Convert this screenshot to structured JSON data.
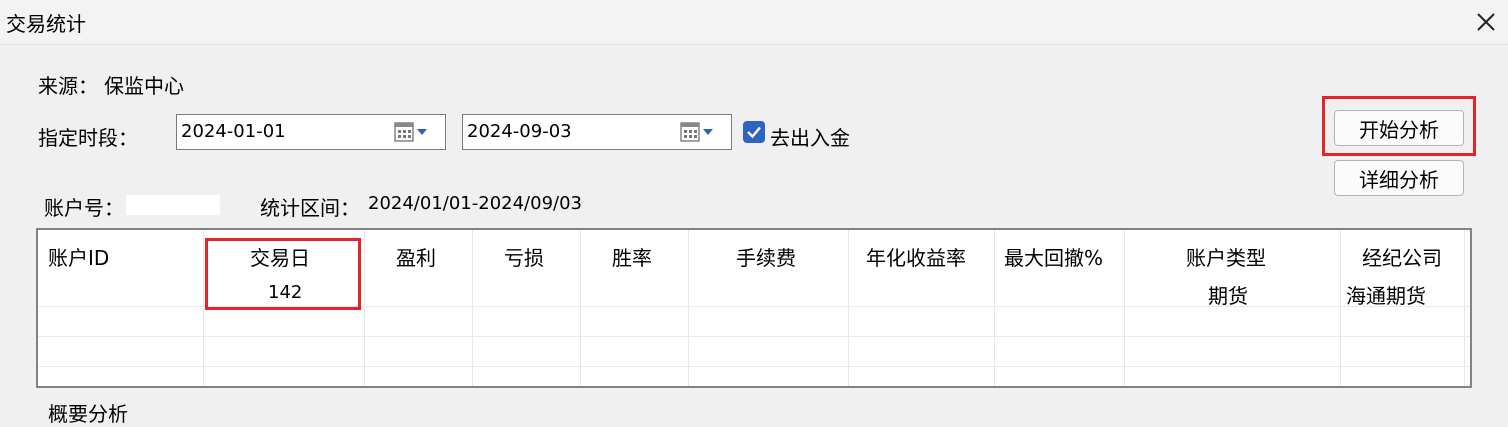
{
  "window": {
    "title": "交易统计"
  },
  "source": {
    "label": "来源：",
    "value": "保监中心"
  },
  "period": {
    "label": "指定时段：",
    "start_date": "2024-01-01",
    "end_date": "2024-09-03",
    "exclude_deposit_label": "去出入金",
    "exclude_deposit_checked": true
  },
  "buttons": {
    "start_analysis": "开始分析",
    "detail_analysis": "详细分析"
  },
  "account": {
    "label": "账户号：",
    "value": ""
  },
  "stat_range": {
    "label": "统计区间：",
    "value": "2024/01/01-2024/09/03"
  },
  "table": {
    "columns": [
      "账户ID",
      "交易日",
      "盈利",
      "亏损",
      "胜率",
      "手续费",
      "年化收益率",
      "最大回撤%",
      "账户类型",
      "经纪公司"
    ],
    "rows": [
      {
        "account_id": "",
        "trade_days": "142",
        "profit": "",
        "loss": "",
        "win_rate": "",
        "fee": "",
        "annual_return": "",
        "max_drawdown": "",
        "account_type": "期货",
        "broker": "海通期货"
      }
    ]
  },
  "next_section": {
    "label": "概要分析"
  },
  "colors": {
    "highlight": "#e3242b",
    "checkbox": "#2f63c0"
  }
}
